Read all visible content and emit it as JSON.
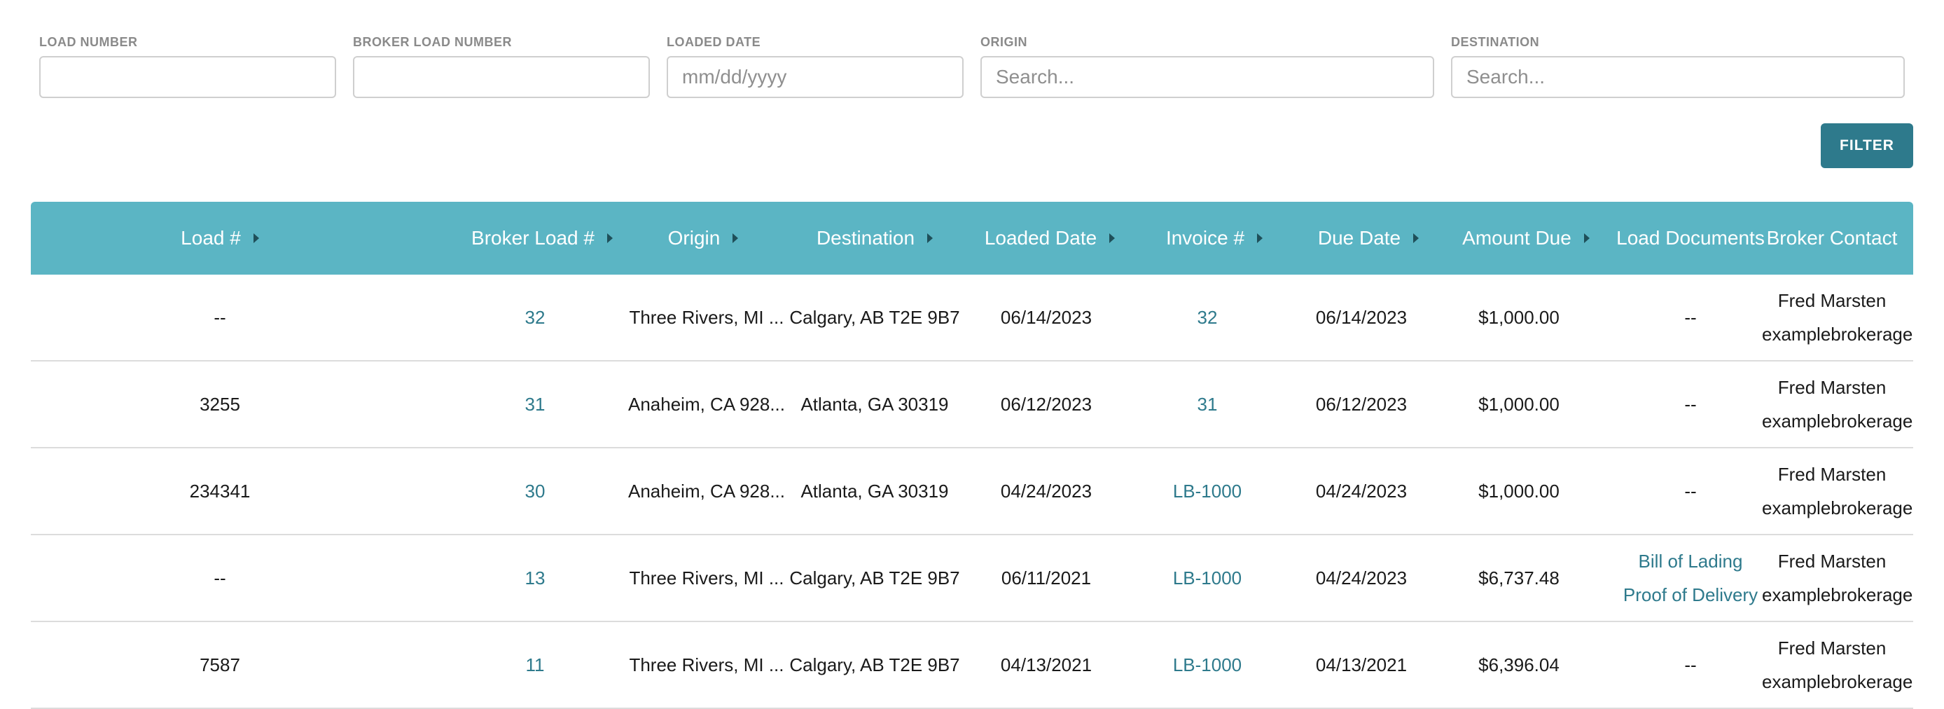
{
  "filters": {
    "load_number": {
      "label": "LOAD NUMBER",
      "value": "",
      "placeholder": ""
    },
    "broker_load_number": {
      "label": "BROKER LOAD NUMBER",
      "value": "",
      "placeholder": ""
    },
    "loaded_date": {
      "label": "LOADED DATE",
      "value": "",
      "placeholder": "mm/dd/yyyy"
    },
    "origin": {
      "label": "ORIGIN",
      "value": "",
      "placeholder": "Search..."
    },
    "destination": {
      "label": "DESTINATION",
      "value": "",
      "placeholder": "Search..."
    },
    "filter_button": "FILTER"
  },
  "table": {
    "headers": {
      "load": "Load #",
      "broker_load": "Broker Load #",
      "origin": "Origin",
      "destination": "Destination",
      "loaded_date": "Loaded Date",
      "invoice": "Invoice #",
      "due_date": "Due Date",
      "amount_due": "Amount Due",
      "load_documents": "Load Documents",
      "broker_contact": "Broker Contact"
    },
    "rows": [
      {
        "load": "--",
        "broker_load": "32",
        "origin": "Three Rivers, MI ...",
        "destination": "Calgary, AB T2E 9B7",
        "loaded_date": "06/14/2023",
        "invoice": "32",
        "due_date": "06/14/2023",
        "amount_due": "$1,000.00",
        "docs": [
          "--"
        ],
        "contact_name": "Fred Marsten",
        "contact_email": "examplebrokerage@t"
      },
      {
        "load": "3255",
        "broker_load": "31",
        "origin": "Anaheim, CA 928...",
        "destination": "Atlanta, GA 30319",
        "loaded_date": "06/12/2023",
        "invoice": "31",
        "due_date": "06/12/2023",
        "amount_due": "$1,000.00",
        "docs": [
          "--"
        ],
        "contact_name": "Fred Marsten",
        "contact_email": "examplebrokerage@t"
      },
      {
        "load": "234341",
        "broker_load": "30",
        "origin": "Anaheim, CA 928...",
        "destination": "Atlanta, GA 30319",
        "loaded_date": "04/24/2023",
        "invoice": "LB-1000",
        "due_date": "04/24/2023",
        "amount_due": "$1,000.00",
        "docs": [
          "--"
        ],
        "contact_name": "Fred Marsten",
        "contact_email": "examplebrokerage@t"
      },
      {
        "load": "--",
        "broker_load": "13",
        "origin": "Three Rivers, MI ...",
        "destination": "Calgary, AB T2E 9B7",
        "loaded_date": "06/11/2021",
        "invoice": "LB-1000",
        "due_date": "04/24/2023",
        "amount_due": "$6,737.48",
        "docs": [
          "Bill of Lading",
          "Proof of Delivery"
        ],
        "contact_name": "Fred Marsten",
        "contact_email": "examplebrokerage@t"
      },
      {
        "load": "7587",
        "broker_load": "11",
        "origin": "Three Rivers, MI ...",
        "destination": "Calgary, AB T2E 9B7",
        "loaded_date": "04/13/2021",
        "invoice": "LB-1000",
        "due_date": "04/13/2021",
        "amount_due": "$6,396.04",
        "docs": [
          "--"
        ],
        "contact_name": "Fred Marsten",
        "contact_email": "examplebrokerage@t"
      }
    ]
  },
  "colors": {
    "header_bg": "#5bb5c4",
    "link": "#2e7a8c",
    "button_bg": "#2e7a8c"
  },
  "icons": {
    "sort": "caret-right-icon"
  }
}
